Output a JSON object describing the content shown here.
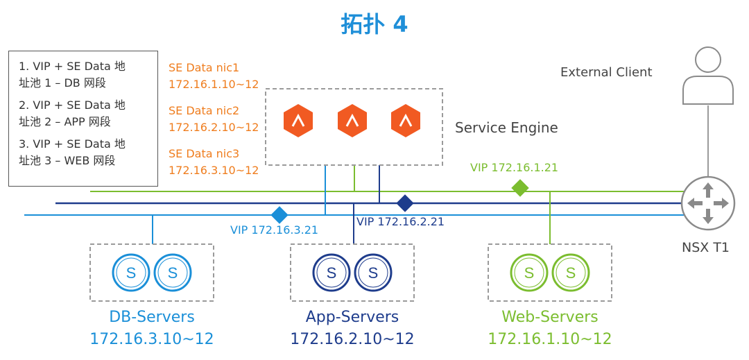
{
  "title": "拓扑 4",
  "legend": [
    "1. VIP + SE Data 地\n址池 1 – DB 网段",
    "2. VIP + SE Data 地\n址池 2 – APP 网段",
    "3. VIP + SE Data 地\n址池 3 – WEB 网段"
  ],
  "nics": [
    "SE Data nic1\n172.16.1.10~12",
    "SE Data nic2\n172.16.2.10~12",
    "SE Data nic3\n172.16.3.10~12"
  ],
  "service_engine_label": "Service Engine",
  "se_icon_glyph": "^",
  "external_client_label": "External Client",
  "router_label": "NSX T1",
  "vips": {
    "web": "VIP 172.16.1.21",
    "app": "VIP 172.16.2.21",
    "db": "VIP 172.16.3.21"
  },
  "server_glyph": "S",
  "groups": {
    "db": {
      "name": "DB-Servers",
      "subnet": "172.16.3.10~12",
      "color": "#1a8fd8"
    },
    "app": {
      "name": "App-Servers",
      "subnet": "172.16.2.10~12",
      "color": "#1e3c8c"
    },
    "web": {
      "name": "Web-Servers",
      "subnet": "172.16.1.10~12",
      "color": "#7bbd2f"
    }
  },
  "colors": {
    "orange": "#ef7d1e",
    "se_red": "#f15a22",
    "gray": "#9a9a9a"
  },
  "icons": [
    "server-engine-icon",
    "user-icon",
    "router-icon",
    "vip-diamond-icon",
    "server-icon"
  ]
}
